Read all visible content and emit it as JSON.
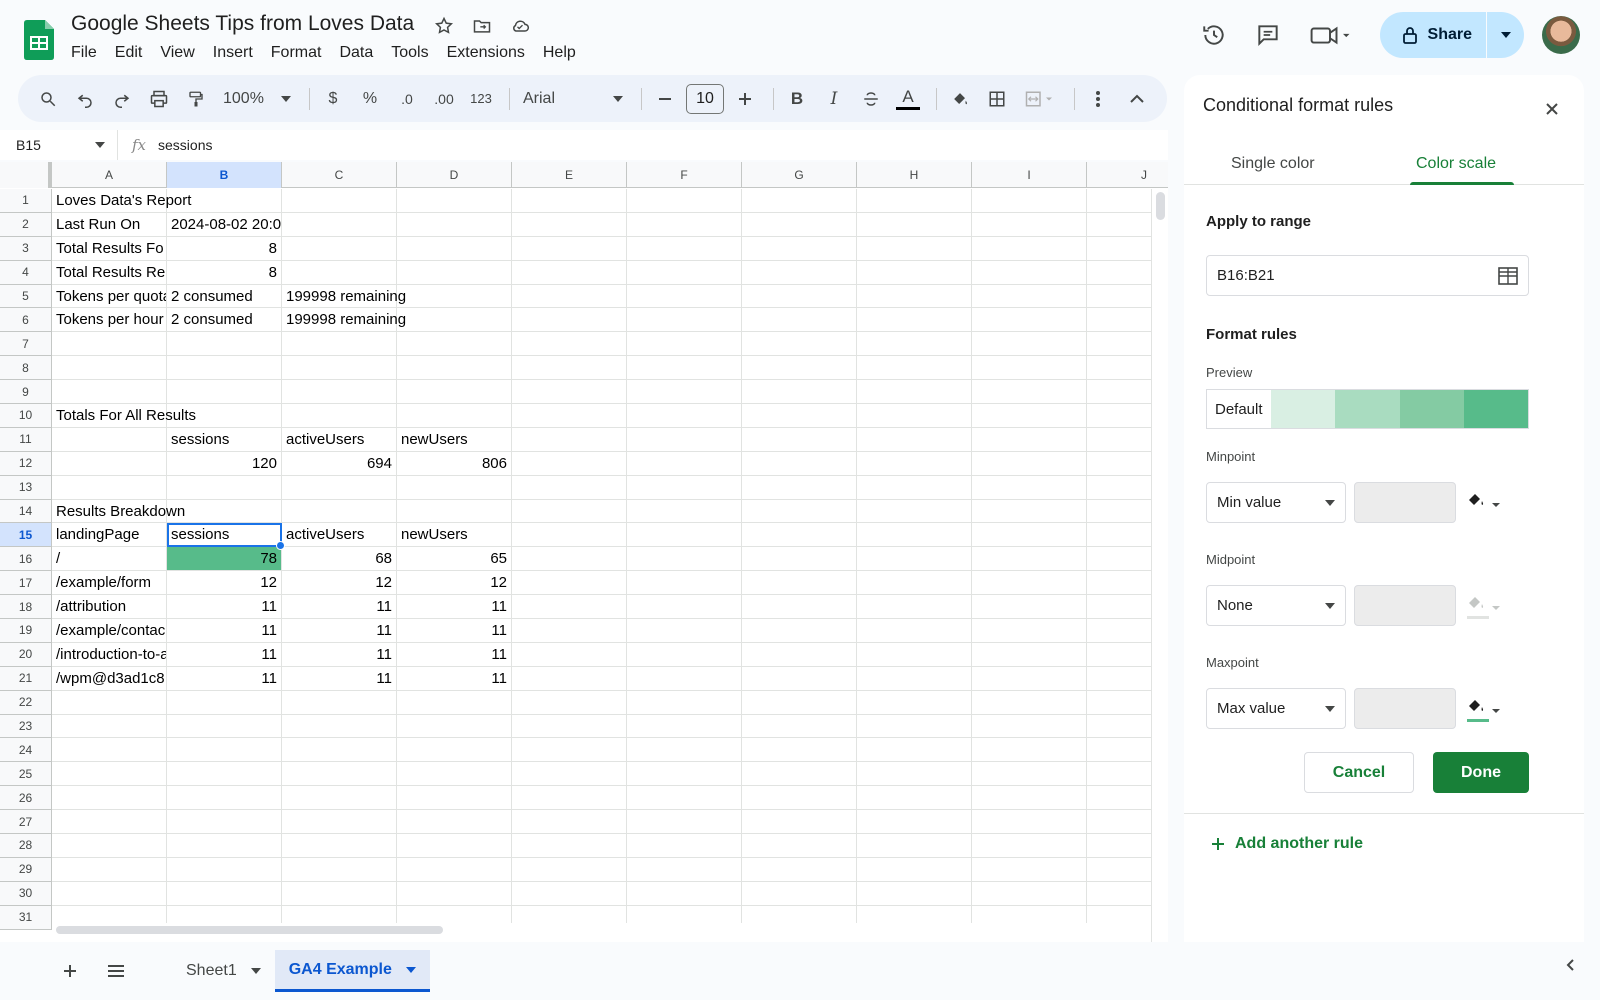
{
  "doc": {
    "title": "Google Sheets Tips from Loves Data"
  },
  "menu": [
    "File",
    "Edit",
    "View",
    "Insert",
    "Format",
    "Data",
    "Tools",
    "Extensions",
    "Help"
  ],
  "header": {
    "share_label": "Share"
  },
  "toolbar": {
    "zoom": "100%",
    "currency": "$",
    "percent": "%",
    "dec_decrease": ".0",
    "dec_increase": ".00",
    "number_format": "123",
    "font": "Arial",
    "font_size": "10",
    "bold": "B",
    "italic": "I",
    "text_color": "A"
  },
  "formula_bar": {
    "cell_ref": "B15",
    "fx": "fx",
    "value": "sessions"
  },
  "grid": {
    "columns": [
      "A",
      "B",
      "C",
      "D",
      "E",
      "F",
      "G",
      "H",
      "I",
      "J"
    ],
    "selected_column": "B",
    "selected_row": "15",
    "rows": [
      {
        "n": "1",
        "cells": [
          "Loves Data's Report",
          "",
          "",
          ""
        ]
      },
      {
        "n": "2",
        "cells": [
          "Last Run On",
          "2024-08-02 20:0",
          "",
          ""
        ]
      },
      {
        "n": "3",
        "cells": [
          "Total Results Fo",
          "8",
          "",
          ""
        ]
      },
      {
        "n": "4",
        "cells": [
          "Total Results Re",
          "8",
          "",
          ""
        ]
      },
      {
        "n": "5",
        "cells": [
          "Tokens per quota",
          "2 consumed",
          "199998 remaining",
          ""
        ]
      },
      {
        "n": "6",
        "cells": [
          "Tokens per hour",
          "2 consumed",
          "199998 remaining",
          ""
        ]
      },
      {
        "n": "7",
        "cells": [
          "",
          "",
          "",
          ""
        ]
      },
      {
        "n": "8",
        "cells": [
          "",
          "",
          "",
          ""
        ]
      },
      {
        "n": "9",
        "cells": [
          "",
          "",
          "",
          ""
        ]
      },
      {
        "n": "10",
        "cells": [
          "Totals For All Results",
          "",
          "",
          ""
        ]
      },
      {
        "n": "11",
        "cells": [
          "",
          "sessions",
          "activeUsers",
          "newUsers"
        ]
      },
      {
        "n": "12",
        "cells": [
          "",
          "120",
          "694",
          "806"
        ]
      },
      {
        "n": "13",
        "cells": [
          "",
          "",
          "",
          ""
        ]
      },
      {
        "n": "14",
        "cells": [
          "Results Breakdown",
          "",
          "",
          ""
        ]
      },
      {
        "n": "15",
        "cells": [
          "landingPage",
          "sessions",
          "activeUsers",
          "newUsers"
        ]
      },
      {
        "n": "16",
        "cells": [
          "/",
          "78",
          "68",
          "65"
        ]
      },
      {
        "n": "17",
        "cells": [
          "/example/form",
          "12",
          "12",
          "12"
        ]
      },
      {
        "n": "18",
        "cells": [
          "/attribution",
          "11",
          "11",
          "11"
        ]
      },
      {
        "n": "19",
        "cells": [
          "/example/contac",
          "11",
          "11",
          "11"
        ]
      },
      {
        "n": "20",
        "cells": [
          "/introduction-to-a",
          "11",
          "11",
          "11"
        ]
      },
      {
        "n": "21",
        "cells": [
          "/wpm@d3ad1c8",
          "11",
          "11",
          "11"
        ]
      },
      {
        "n": "22",
        "cells": [
          "",
          "",
          "",
          ""
        ]
      },
      {
        "n": "23",
        "cells": [
          "",
          "",
          "",
          ""
        ]
      },
      {
        "n": "24",
        "cells": [
          "",
          "",
          "",
          ""
        ]
      },
      {
        "n": "25",
        "cells": [
          "",
          "",
          "",
          ""
        ]
      },
      {
        "n": "26",
        "cells": [
          "",
          "",
          "",
          ""
        ]
      },
      {
        "n": "27",
        "cells": [
          "",
          "",
          "",
          ""
        ]
      },
      {
        "n": "28",
        "cells": [
          "",
          "",
          "",
          ""
        ]
      },
      {
        "n": "29",
        "cells": [
          "",
          "",
          "",
          ""
        ]
      },
      {
        "n": "30",
        "cells": [
          "",
          "",
          "",
          ""
        ]
      },
      {
        "n": "31",
        "cells": [
          "",
          "",
          "",
          ""
        ]
      }
    ]
  },
  "sheets": [
    {
      "name": "Sheet1",
      "active": false
    },
    {
      "name": "GA4 Example",
      "active": true
    }
  ],
  "panel": {
    "title": "Conditional format rules",
    "tabs": [
      "Single color",
      "Color scale"
    ],
    "active_tab": "Color scale",
    "apply_label": "Apply to range",
    "range": "B16:B21",
    "rules_label": "Format rules",
    "preview_label": "Preview",
    "preview_default": "Default",
    "preview_colors": [
      "#d9efe3",
      "#a9dcc0",
      "#84cba3",
      "#57bb8a"
    ],
    "minpoint_label": "Minpoint",
    "minpoint_value": "Min value",
    "midpoint_label": "Midpoint",
    "midpoint_value": "None",
    "maxpoint_label": "Maxpoint",
    "maxpoint_value": "Max value",
    "max_color": "#57bb8a",
    "cancel_label": "Cancel",
    "done_label": "Done",
    "add_rule_label": "Add another rule"
  },
  "colors": {
    "accent_green": "#188038",
    "selection_blue": "#1a73e8",
    "scale_max": "#57bb8a"
  }
}
